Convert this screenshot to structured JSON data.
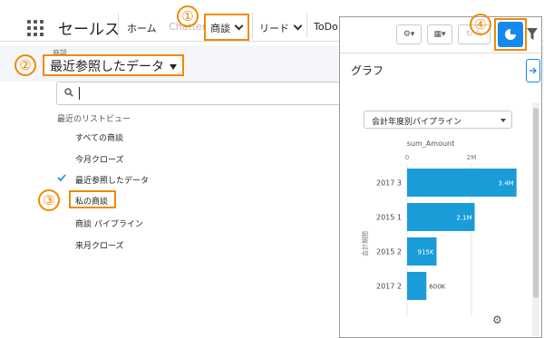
{
  "app": {
    "name": "セールス"
  },
  "nav": {
    "home": "ホーム",
    "chatter": "Chatter",
    "opportunities": "商談",
    "leads": "リード",
    "todo": "ToDo"
  },
  "list_view": {
    "object_label": "商談",
    "current_view": "最近参照したデータ",
    "search_placeholder": "",
    "recent_heading": "最近のリストビュー",
    "items": [
      {
        "label": "すべての商談",
        "checked": false
      },
      {
        "label": "今月クローズ",
        "checked": false
      },
      {
        "label": "最近参照したデータ",
        "checked": true
      },
      {
        "label": "私の商談",
        "checked": false
      },
      {
        "label": "商談 パイプライン",
        "checked": false
      },
      {
        "label": "来月クローズ",
        "checked": false
      }
    ]
  },
  "callouts": {
    "c1": "①",
    "c2": "②",
    "c3": "③",
    "c4": "④"
  },
  "chart_panel": {
    "title": "グラフ",
    "selected_chart": "会計年度別パイプライン",
    "accent_color": "#1589ee",
    "callout_color": "#f08a00"
  },
  "chart_data": {
    "type": "bar",
    "orientation": "horizontal",
    "title": "sum_Amount",
    "ylabel": "会計期間",
    "xlim": [
      0,
      4000000
    ],
    "x_ticks": [
      "0",
      "2M"
    ],
    "categories": [
      "2017 3",
      "2015 1",
      "2015 2",
      "2017 2"
    ],
    "values": [
      3400000,
      2100000,
      915000,
      600000
    ],
    "value_labels": [
      "3.4M",
      "2.1M",
      "915K",
      "600K"
    ],
    "bar_color": "#1a9cd8"
  }
}
